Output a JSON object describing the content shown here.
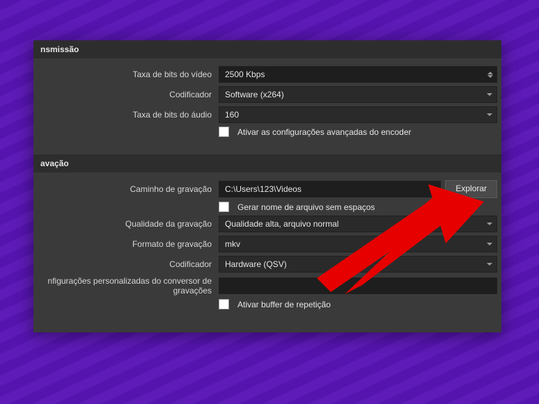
{
  "sections": {
    "streaming": {
      "header": "nsmissão",
      "videoBitrate": {
        "label": "Taxa de bits do vídeo",
        "value": "2500 Kbps"
      },
      "encoder": {
        "label": "Codificador",
        "value": "Software (x264)"
      },
      "audioBitrate": {
        "label": "Taxa de bits do áudio",
        "value": "160"
      },
      "advancedCheck": {
        "label": "Ativar as configurações avançadas do encoder"
      }
    },
    "recording": {
      "header": "avação",
      "path": {
        "label": "Caminho de gravação",
        "value": "C:\\Users\\123\\Videos",
        "browse": "Explorar"
      },
      "noSpace": {
        "label": "Gerar nome de arquivo sem espaços"
      },
      "quality": {
        "label": "Qualidade da gravação",
        "value": "Qualidade alta, arquivo normal"
      },
      "format": {
        "label": "Formato de gravação",
        "value": "mkv"
      },
      "encoder": {
        "label": "Codificador",
        "value": "Hardware (QSV)"
      },
      "muxer": {
        "label": "nfigurações personalizadas do conversor de gravações",
        "value": ""
      },
      "replay": {
        "label": "Ativar buffer de repetição"
      }
    }
  }
}
